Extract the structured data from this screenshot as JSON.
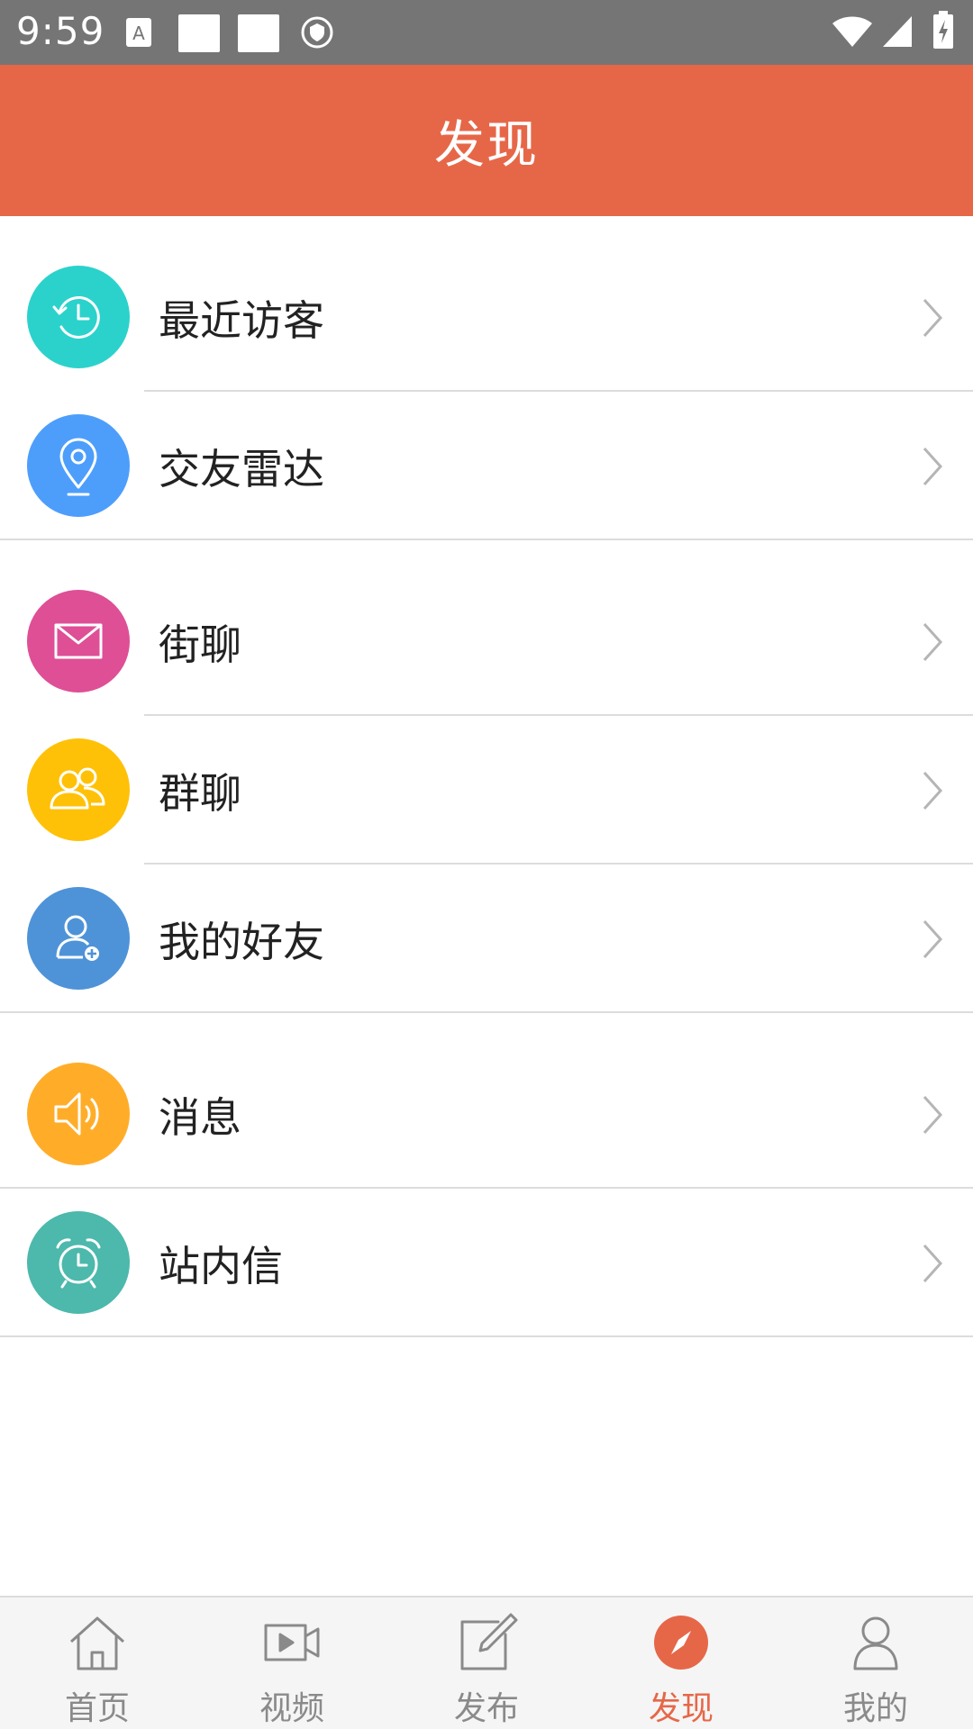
{
  "status_bar": {
    "time": "9:59"
  },
  "header": {
    "title": "发现"
  },
  "groups": [
    [
      {
        "label": "最近访客",
        "icon": "history-clock-icon",
        "color": "#2bd2cc"
      },
      {
        "label": "交友雷达",
        "icon": "location-pin-icon",
        "color": "#4d9efb"
      }
    ],
    [
      {
        "label": "街聊",
        "icon": "mail-icon",
        "color": "#de4f96"
      },
      {
        "label": "群聊",
        "icon": "group-users-icon",
        "color": "#ffc107"
      },
      {
        "label": "我的好友",
        "icon": "add-friend-icon",
        "color": "#4e93d8"
      }
    ],
    [
      {
        "label": "消息",
        "icon": "speaker-icon",
        "color": "#ffad29"
      },
      {
        "label": "站内信",
        "icon": "alarm-clock-icon",
        "color": "#4db8ac"
      }
    ]
  ],
  "bottom_nav": [
    {
      "label": "首页",
      "icon": "home-icon",
      "active": false
    },
    {
      "label": "视频",
      "icon": "video-icon",
      "active": false
    },
    {
      "label": "发布",
      "icon": "edit-icon",
      "active": false
    },
    {
      "label": "发现",
      "icon": "compass-icon",
      "active": true
    },
    {
      "label": "我的",
      "icon": "user-icon",
      "active": false
    }
  ],
  "colors": {
    "accent": "#e66748",
    "status_bar": "#757575",
    "nav_inactive": "#8a8a8a"
  }
}
